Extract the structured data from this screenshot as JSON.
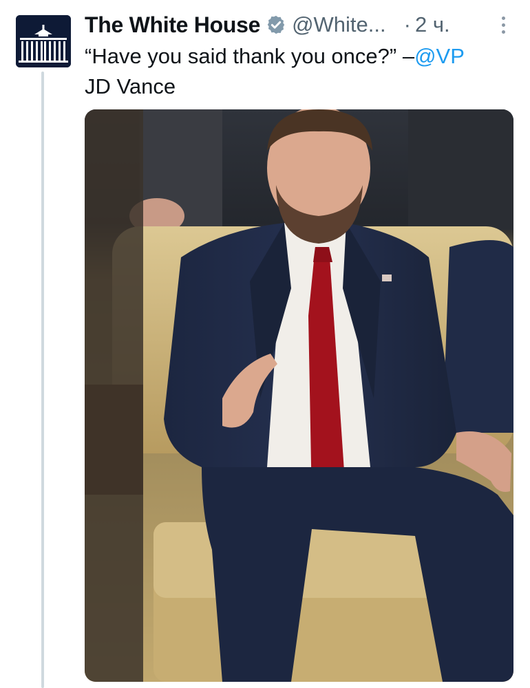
{
  "tweet": {
    "author_name": "The White House",
    "handle": "@White...",
    "separator": "·",
    "time": "2 ч.",
    "text_part1": "“Have you said thank you once?” –",
    "mention": "@VP",
    "text_part2": "JD Vance"
  },
  "icons": {
    "avatar": "white-house-logo",
    "verified": "verified-badge-icon",
    "more": "more-vertical-icon"
  },
  "colors": {
    "link": "#1d9bf0",
    "verified_badge": "#829aab",
    "secondary_text": "#536471"
  }
}
